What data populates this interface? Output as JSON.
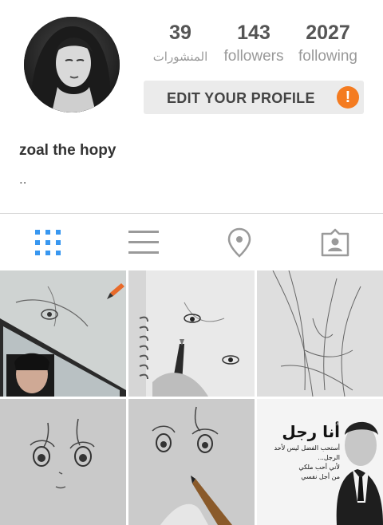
{
  "profile": {
    "username": "zoal the hopy",
    "bio": "..",
    "stats": [
      {
        "value": "39",
        "label": "المنشورات"
      },
      {
        "value": "143",
        "label": "followers"
      },
      {
        "value": "2027",
        "label": "following"
      }
    ],
    "edit_button_label": "EDIT YOUR PROFILE",
    "alert_glyph": "!"
  },
  "tabs": [
    {
      "icon": "grid-icon",
      "active": true
    },
    {
      "icon": "list-icon",
      "active": false
    },
    {
      "icon": "location-pin-icon",
      "active": false
    },
    {
      "icon": "tagged-photos-icon",
      "active": false
    }
  ],
  "colors": {
    "accent_blue": "#3897f0",
    "alert_orange": "#f47b20",
    "tab_inactive": "#9a9a9a"
  },
  "posts": {
    "poster_text": {
      "title": "أنا رجل",
      "line1": "أستحب الفضل ليس لأحد الرجل... ",
      "line2": "لأني أحب ملكي",
      "line3": "من أجل نفسي"
    }
  }
}
